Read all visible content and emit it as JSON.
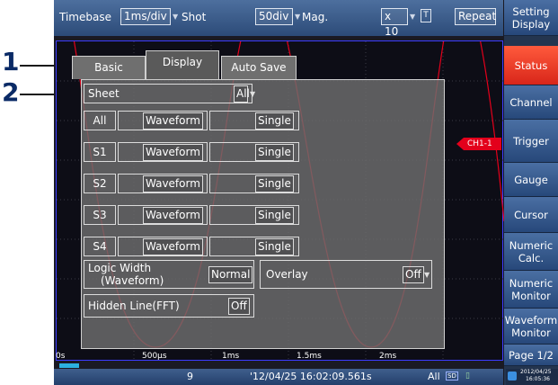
{
  "callouts": {
    "first": "1",
    "second": "2"
  },
  "topbar": {
    "timebase_label": "Timebase",
    "timebase_value": "1ms/div",
    "shot_label": "Shot",
    "shot_value": "50div",
    "mag_label": "Mag.",
    "mag_value": "x 10",
    "repeat_label": "Repeat"
  },
  "sidebar": {
    "items": [
      {
        "label": "Setting Display",
        "active": false
      },
      {
        "label": "Status",
        "active": true
      },
      {
        "label": "Channel",
        "active": false
      },
      {
        "label": "Trigger",
        "active": false
      },
      {
        "label": "Gauge",
        "active": false
      },
      {
        "label": "Cursor",
        "active": false
      },
      {
        "label": "Numeric Calc.",
        "active": false
      },
      {
        "label": "Numeric Monitor",
        "active": false
      },
      {
        "label": "Waveform Monitor",
        "active": false
      },
      {
        "label": "Page 1/2",
        "active": false
      }
    ]
  },
  "tabs": {
    "basic": "Basic",
    "display": "Display",
    "autosave": "Auto Save"
  },
  "panel": {
    "sheet_label": "Sheet",
    "sheet_value": "All",
    "rows": [
      {
        "name": "All",
        "type": "Waveform",
        "mode": "Single"
      },
      {
        "name": "S1",
        "type": "Waveform",
        "mode": "Single"
      },
      {
        "name": "S2",
        "type": "Waveform",
        "mode": "Single"
      },
      {
        "name": "S3",
        "type": "Waveform",
        "mode": "Single"
      },
      {
        "name": "S4",
        "type": "Waveform",
        "mode": "Single"
      }
    ],
    "logic_width_label_1": "Logic Width",
    "logic_width_label_2": "(Waveform)",
    "logic_width_value": "Normal",
    "overlay_label": "Overlay",
    "overlay_value": "Off",
    "hidden_line_label": "Hidden Line(FFT)",
    "hidden_line_value": "Off"
  },
  "channel_marker": "CH1-1",
  "axis": {
    "t0": "0s",
    "t1": "500µs",
    "t2": "1ms",
    "t3": "1.5ms",
    "t4": "2ms"
  },
  "status": {
    "count": "9",
    "datetime": "'12/04/25 16:02:09.561s",
    "sheet": "All",
    "sd_label": "SD",
    "clock_date": "2012/04/25",
    "clock_time": "16:05:36"
  },
  "colors": {
    "active": "#e82a1e",
    "waveform": "#e3001b",
    "grid_border": "#3c3cff"
  }
}
